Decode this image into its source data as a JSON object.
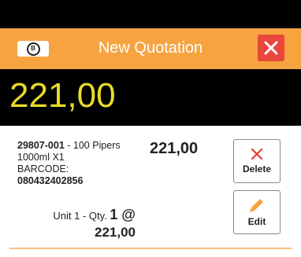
{
  "header": {
    "title": "New Quotation",
    "brand_color": "#f7a340",
    "close_color": "#e9463c"
  },
  "total": {
    "amount": "221,00",
    "color": "#e8dc28"
  },
  "item": {
    "sku": "29807-001",
    "description": "- 100 Pipers 1000ml X1",
    "barcode_label": "BARCODE:",
    "barcode": "080432402856",
    "price": "221,00",
    "qty_label": "Unit 1 - Qty.",
    "qty": "1 @",
    "unit_price": "221,00"
  },
  "actions": {
    "delete_label": "Delete",
    "edit_label": "Edit"
  },
  "icons": {
    "logo": "brand-logo",
    "close": "close-icon",
    "delete": "x-icon",
    "edit": "pencil-icon"
  }
}
